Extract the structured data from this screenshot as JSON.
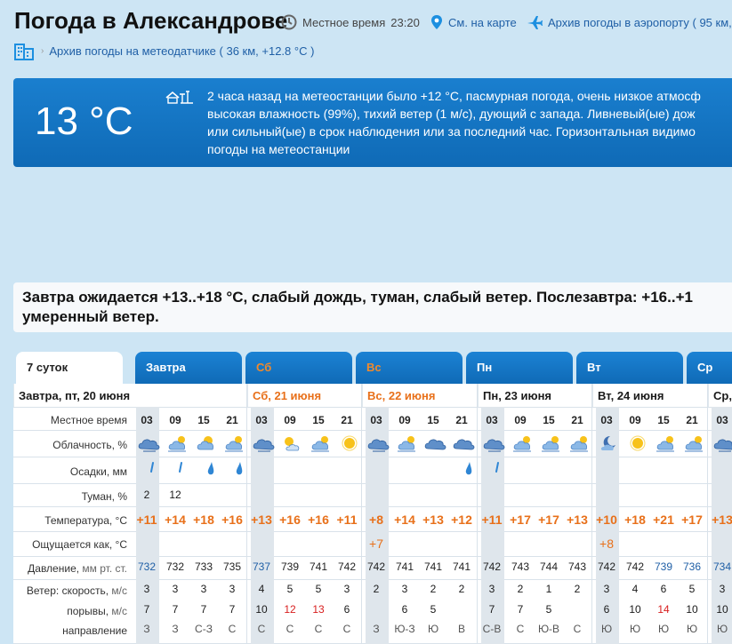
{
  "header": {
    "title": "Погода в Александрове",
    "local_time_label": "Местное время",
    "local_time": "23:20",
    "map_link": "См. на карте",
    "airport_link": "Архив погоды в аэропорту ( 95 км, +",
    "sensor_link": "Архив погоды на метеодатчике ( 36 км, +12.8 °C )"
  },
  "now": {
    "temp": "13 °C",
    "text_lines": [
      "2 часа назад на метеостанции было +12 °C, пасмурная погода, очень низкое атмосф",
      "высокая влажность (99%), тихий ветер (1 м/с), дующий с запада. Ливневый(ые) дож",
      "или сильный(ые) в срок наблюдения или за последний час. Горизонтальная видимо",
      "погоды на метеостанции"
    ]
  },
  "summary": {
    "line1": "Завтра ожидается +13..+18 °C, слабый дождь, туман, слабый ветер. Послезавтра: +16..+1",
    "line2": "умеренный ветер."
  },
  "tabs": [
    {
      "label": "7 суток",
      "active": true,
      "weekend": false
    },
    {
      "label": "Завтра",
      "active": false,
      "weekend": false
    },
    {
      "label": "Сб",
      "active": false,
      "weekend": true
    },
    {
      "label": "Вс",
      "active": false,
      "weekend": true
    },
    {
      "label": "Пн",
      "active": false,
      "weekend": false
    },
    {
      "label": "Вт",
      "active": false,
      "weekend": false
    },
    {
      "label": "Ср",
      "active": false,
      "weekend": false
    }
  ],
  "row_labels": {
    "time": "Местное время",
    "clouds": "Облачность, %",
    "precip": "Осадки, мм",
    "fog": "Туман, %",
    "temp": "Температура, °C",
    "feels": "Ощущается как, °C",
    "pressure": "Давление,",
    "pressure_unit": "мм рт. ст.",
    "wind_speed": "Ветер: скорость,",
    "wind_speed_unit": "м/с",
    "gusts": "порывы,",
    "gusts_unit": "м/с",
    "direction": "направление"
  },
  "days": [
    {
      "title": "Завтра, пт, 20 июня",
      "weekend": false,
      "hours": [
        "03",
        "09",
        "15",
        "21"
      ],
      "clouds": [
        "cloud-night-icon",
        "partly-cloudy-icon",
        "partly-sunny-icon",
        "partly-cloudy-icon"
      ],
      "precip": [
        "light",
        "light",
        "medium",
        "medium"
      ],
      "fog": [
        "2",
        "12",
        "",
        ""
      ],
      "temp": [
        "+11",
        "+14",
        "+18",
        "+16"
      ],
      "feels": [
        "",
        "",
        "",
        ""
      ],
      "pressure": [
        "732",
        "732",
        "733",
        "735"
      ],
      "pressure_low": [
        true,
        false,
        false,
        false
      ],
      "wind": [
        "3",
        "3",
        "3",
        "3"
      ],
      "gusts": [
        "7",
        "7",
        "7",
        "7"
      ],
      "gust_high": [
        false,
        false,
        false,
        false
      ],
      "dir": [
        "З",
        "З",
        "С-З",
        "С"
      ]
    },
    {
      "title": "Сб, 21 июня",
      "weekend": true,
      "hours": [
        "03",
        "09",
        "15",
        "21"
      ],
      "clouds": [
        "cloud-night-icon",
        "sun-cloud-icon",
        "partly-cloudy-icon",
        "sun-icon"
      ],
      "precip": [
        "",
        "",
        "",
        ""
      ],
      "fog": [
        "",
        "",
        "",
        ""
      ],
      "temp": [
        "+13",
        "+16",
        "+16",
        "+11"
      ],
      "feels": [
        "",
        "",
        "",
        ""
      ],
      "pressure": [
        "737",
        "739",
        "741",
        "742"
      ],
      "pressure_low": [
        true,
        false,
        false,
        false
      ],
      "wind": [
        "4",
        "5",
        "5",
        "3"
      ],
      "gusts": [
        "10",
        "12",
        "13",
        "6"
      ],
      "gust_high": [
        false,
        true,
        true,
        false
      ],
      "dir": [
        "С",
        "С",
        "С",
        "С"
      ]
    },
    {
      "title": "Вс, 22 июня",
      "weekend": true,
      "hours": [
        "03",
        "09",
        "15",
        "21"
      ],
      "clouds": [
        "cloud-night-icon",
        "partly-cloudy-icon",
        "cloudy-icon",
        "cloudy-icon"
      ],
      "precip": [
        "",
        "",
        "",
        "medium"
      ],
      "fog": [
        "",
        "",
        "",
        ""
      ],
      "temp": [
        "+8",
        "+14",
        "+13",
        "+12"
      ],
      "feels": [
        "+7",
        "",
        "",
        ""
      ],
      "pressure": [
        "742",
        "741",
        "741",
        "741"
      ],
      "pressure_low": [
        false,
        false,
        false,
        false
      ],
      "wind": [
        "2",
        "3",
        "2",
        "2"
      ],
      "gusts": [
        "",
        "6",
        "5",
        ""
      ],
      "gust_high": [
        false,
        false,
        false,
        false
      ],
      "dir": [
        "З",
        "Ю-З",
        "Ю",
        "В"
      ]
    },
    {
      "title": "Пн, 23 июня",
      "weekend": false,
      "hours": [
        "03",
        "09",
        "15",
        "21"
      ],
      "clouds": [
        "cloud-night-icon",
        "partly-cloudy-icon",
        "partly-cloudy-icon",
        "partly-cloudy-icon"
      ],
      "precip": [
        "light",
        "",
        "",
        ""
      ],
      "fog": [
        "",
        "",
        "",
        ""
      ],
      "temp": [
        "+11",
        "+17",
        "+17",
        "+13"
      ],
      "feels": [
        "",
        "",
        "",
        ""
      ],
      "pressure": [
        "742",
        "743",
        "744",
        "743"
      ],
      "pressure_low": [
        false,
        false,
        false,
        false
      ],
      "wind": [
        "3",
        "2",
        "1",
        "2"
      ],
      "gusts": [
        "7",
        "7",
        "5",
        ""
      ],
      "gust_high": [
        false,
        false,
        false,
        false
      ],
      "dir": [
        "С-В",
        "С",
        "Ю-В",
        "С"
      ]
    },
    {
      "title": "Вт, 24 июня",
      "weekend": false,
      "hours": [
        "03",
        "09",
        "15",
        "21"
      ],
      "clouds": [
        "moon-cloud-icon",
        "sun-icon",
        "partly-cloudy-icon",
        "partly-cloudy-icon"
      ],
      "precip": [
        "",
        "",
        "",
        ""
      ],
      "fog": [
        "",
        "",
        "",
        ""
      ],
      "temp": [
        "+10",
        "+18",
        "+21",
        "+17"
      ],
      "feels": [
        "+8",
        "",
        "",
        ""
      ],
      "pressure": [
        "742",
        "742",
        "739",
        "736"
      ],
      "pressure_low": [
        false,
        false,
        true,
        true
      ],
      "wind": [
        "3",
        "4",
        "6",
        "5"
      ],
      "gusts": [
        "6",
        "10",
        "14",
        "10"
      ],
      "gust_high": [
        false,
        false,
        true,
        false
      ],
      "dir": [
        "Ю",
        "Ю",
        "Ю",
        "Ю"
      ]
    },
    {
      "title": "Ср,",
      "weekend": false,
      "hours": [
        "03"
      ],
      "clouds": [
        "cloud-night-icon"
      ],
      "precip": [
        ""
      ],
      "fog": [
        ""
      ],
      "temp": [
        "+13"
      ],
      "feels": [
        ""
      ],
      "pressure": [
        "734"
      ],
      "pressure_low": [
        true
      ],
      "wind": [
        "3"
      ],
      "gusts": [
        "10"
      ],
      "gust_high": [
        false
      ],
      "dir": [
        "Ю"
      ]
    }
  ],
  "colors": {
    "accent": "#1f5fa6",
    "panel_blue": "#1576c4",
    "warm": "#e8701a",
    "gust_red": "#d81e1e",
    "background": "#cde5f4"
  }
}
